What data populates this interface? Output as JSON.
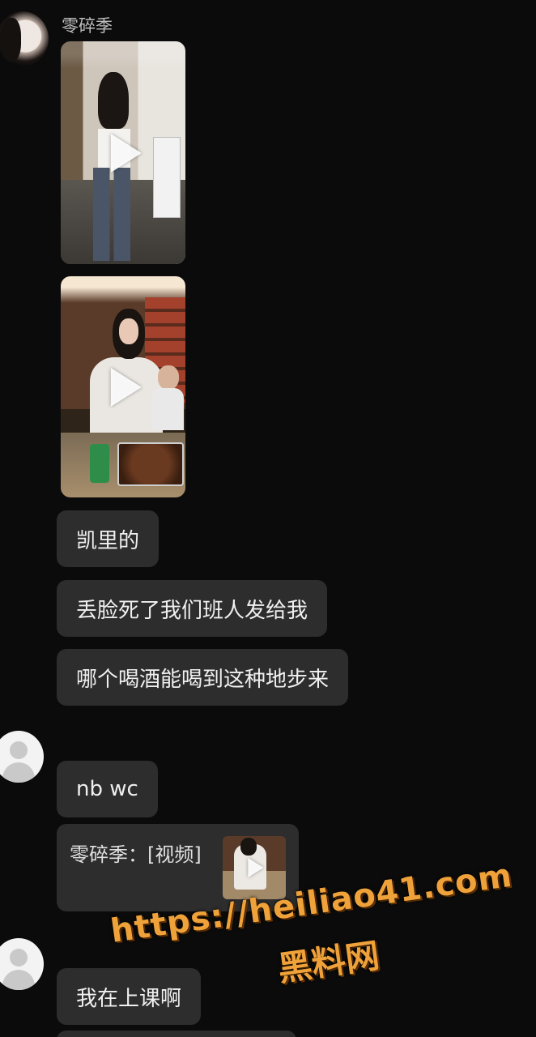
{
  "sender": {
    "name": "零碎季"
  },
  "messages": [
    {
      "type": "video",
      "id": "video-1"
    },
    {
      "type": "video",
      "id": "video-2"
    },
    {
      "type": "text",
      "text": "凯里的"
    },
    {
      "type": "text",
      "text": "丢脸死了我们班人发给我"
    },
    {
      "type": "text",
      "text": "哪个喝酒能喝到这种地步来"
    },
    {
      "type": "text",
      "text": "nb wc"
    },
    {
      "type": "forward",
      "text": "零碎季：[视频]"
    },
    {
      "type": "text",
      "text": "我在上课啊"
    }
  ],
  "watermark": {
    "url": "https://heiliao41.com",
    "name": "黑料网",
    "color": "#f0a23a"
  },
  "icons": {
    "play": "play-icon",
    "default_avatar": "default-avatar-icon"
  },
  "colors": {
    "background": "#0b0b0b",
    "bubble": "#2d2d2d",
    "text": "#f0f0f0"
  }
}
